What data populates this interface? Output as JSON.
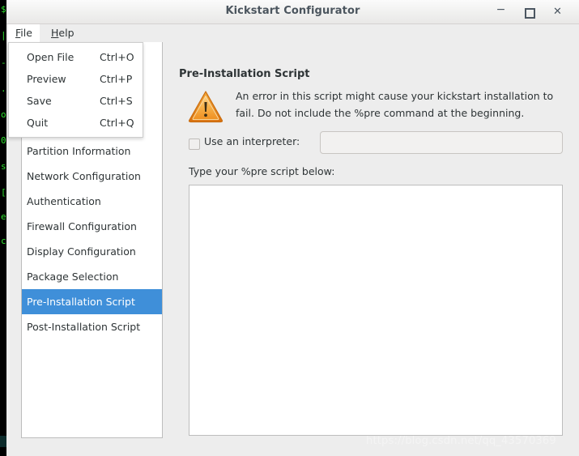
{
  "window": {
    "title": "Kickstart Configurator",
    "controls": {
      "minimize": "−",
      "maximize": "",
      "close": "✕"
    }
  },
  "menubar": {
    "items": [
      {
        "label_pre": "",
        "mnemonic": "F",
        "label_post": "ile",
        "name": "file"
      },
      {
        "label_pre": "",
        "mnemonic": "H",
        "label_post": "elp",
        "name": "help"
      }
    ]
  },
  "file_menu": {
    "open": true,
    "items": [
      {
        "label": "Open File",
        "accel": "Ctrl+O"
      },
      {
        "label": "Preview",
        "accel": "Ctrl+P"
      },
      {
        "label": "Save",
        "accel": "Ctrl+S"
      },
      {
        "label": "Quit",
        "accel": "Ctrl+Q"
      }
    ]
  },
  "sidebar": {
    "selected": "Pre-Installation Script",
    "items": [
      {
        "label": "Partition Information",
        "selected": false
      },
      {
        "label": "Network Configuration",
        "selected": false
      },
      {
        "label": "Authentication",
        "selected": false
      },
      {
        "label": "Firewall Configuration",
        "selected": false
      },
      {
        "label": "Display Configuration",
        "selected": false
      },
      {
        "label": "Package Selection",
        "selected": false
      },
      {
        "label": "Pre-Installation Script",
        "selected": true
      },
      {
        "label": "Post-Installation Script",
        "selected": false
      }
    ]
  },
  "panel": {
    "heading": "Pre-Installation Script",
    "warning": {
      "icon": "warning-triangle-icon",
      "text": "An error in this script might cause your kickstart installation to fail. Do not include the %pre command at the beginning.",
      "color": "#f0a030"
    },
    "interpreter": {
      "checkbox_label": "Use an interpreter:",
      "checked": false,
      "value": "",
      "placeholder": "",
      "enabled": false
    },
    "script": {
      "label": "Type your %pre script below:",
      "value": "",
      "placeholder": ""
    }
  },
  "watermark": {
    "text": "https://blog.csdn.net/qq_43570369"
  },
  "background_terminal": {
    "lines": [
      "$",
      "|",
      "-",
      ".",
      "o",
      "0",
      "s",
      "[",
      "e",
      "c"
    ]
  },
  "colors": {
    "accent_selection": "#3f8fd9",
    "window_bg": "#ededed",
    "titlebar_text": "#4b555e",
    "warning_orange": "#f0a030"
  }
}
